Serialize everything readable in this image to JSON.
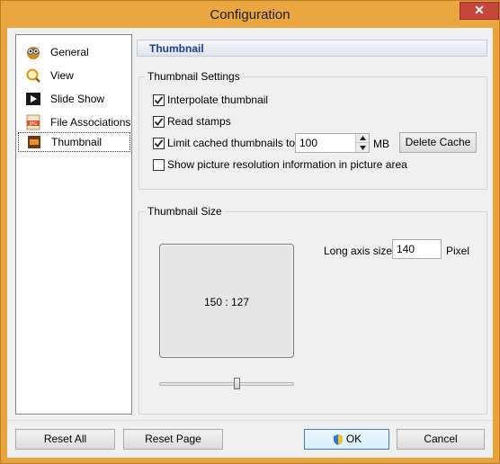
{
  "window": {
    "title": "Configuration",
    "close_glyph": "✕"
  },
  "nav": {
    "items": [
      {
        "label": "General",
        "icon": "owl-icon"
      },
      {
        "label": "View",
        "icon": "magnifier-icon"
      },
      {
        "label": "Slide Show",
        "icon": "play-icon"
      },
      {
        "label": "File Associations",
        "icon": "jpg-file-icon"
      },
      {
        "label": "Thumbnail",
        "icon": "thumbnail-icon",
        "selected": true
      }
    ]
  },
  "panel": {
    "header": "Thumbnail"
  },
  "thumbnail_settings": {
    "group_title": "Thumbnail Settings",
    "interpolate": {
      "label": "Interpolate thumbnail",
      "checked": true
    },
    "read_stamps": {
      "label": "Read stamps",
      "checked": true
    },
    "limit_cache": {
      "label": "Limit cached thumbnails to",
      "checked": true,
      "value": "100",
      "unit": "MB"
    },
    "delete_cache_label": "Delete Cache",
    "show_resolution": {
      "label": "Show picture resolution information in picture area",
      "checked": false
    }
  },
  "thumbnail_size": {
    "group_title": "Thumbnail Size",
    "preview_text": "150 : 127",
    "long_axis_label": "Long axis size",
    "long_axis_value": "140",
    "unit": "Pixel",
    "slider_fraction": 0.58
  },
  "footer": {
    "reset_all": "Reset All",
    "reset_page": "Reset Page",
    "ok": "OK",
    "cancel": "Cancel"
  },
  "colors": {
    "title_bar": "#eaa73f",
    "header_text": "#1f3d8a",
    "close_button": "#c7463b"
  }
}
